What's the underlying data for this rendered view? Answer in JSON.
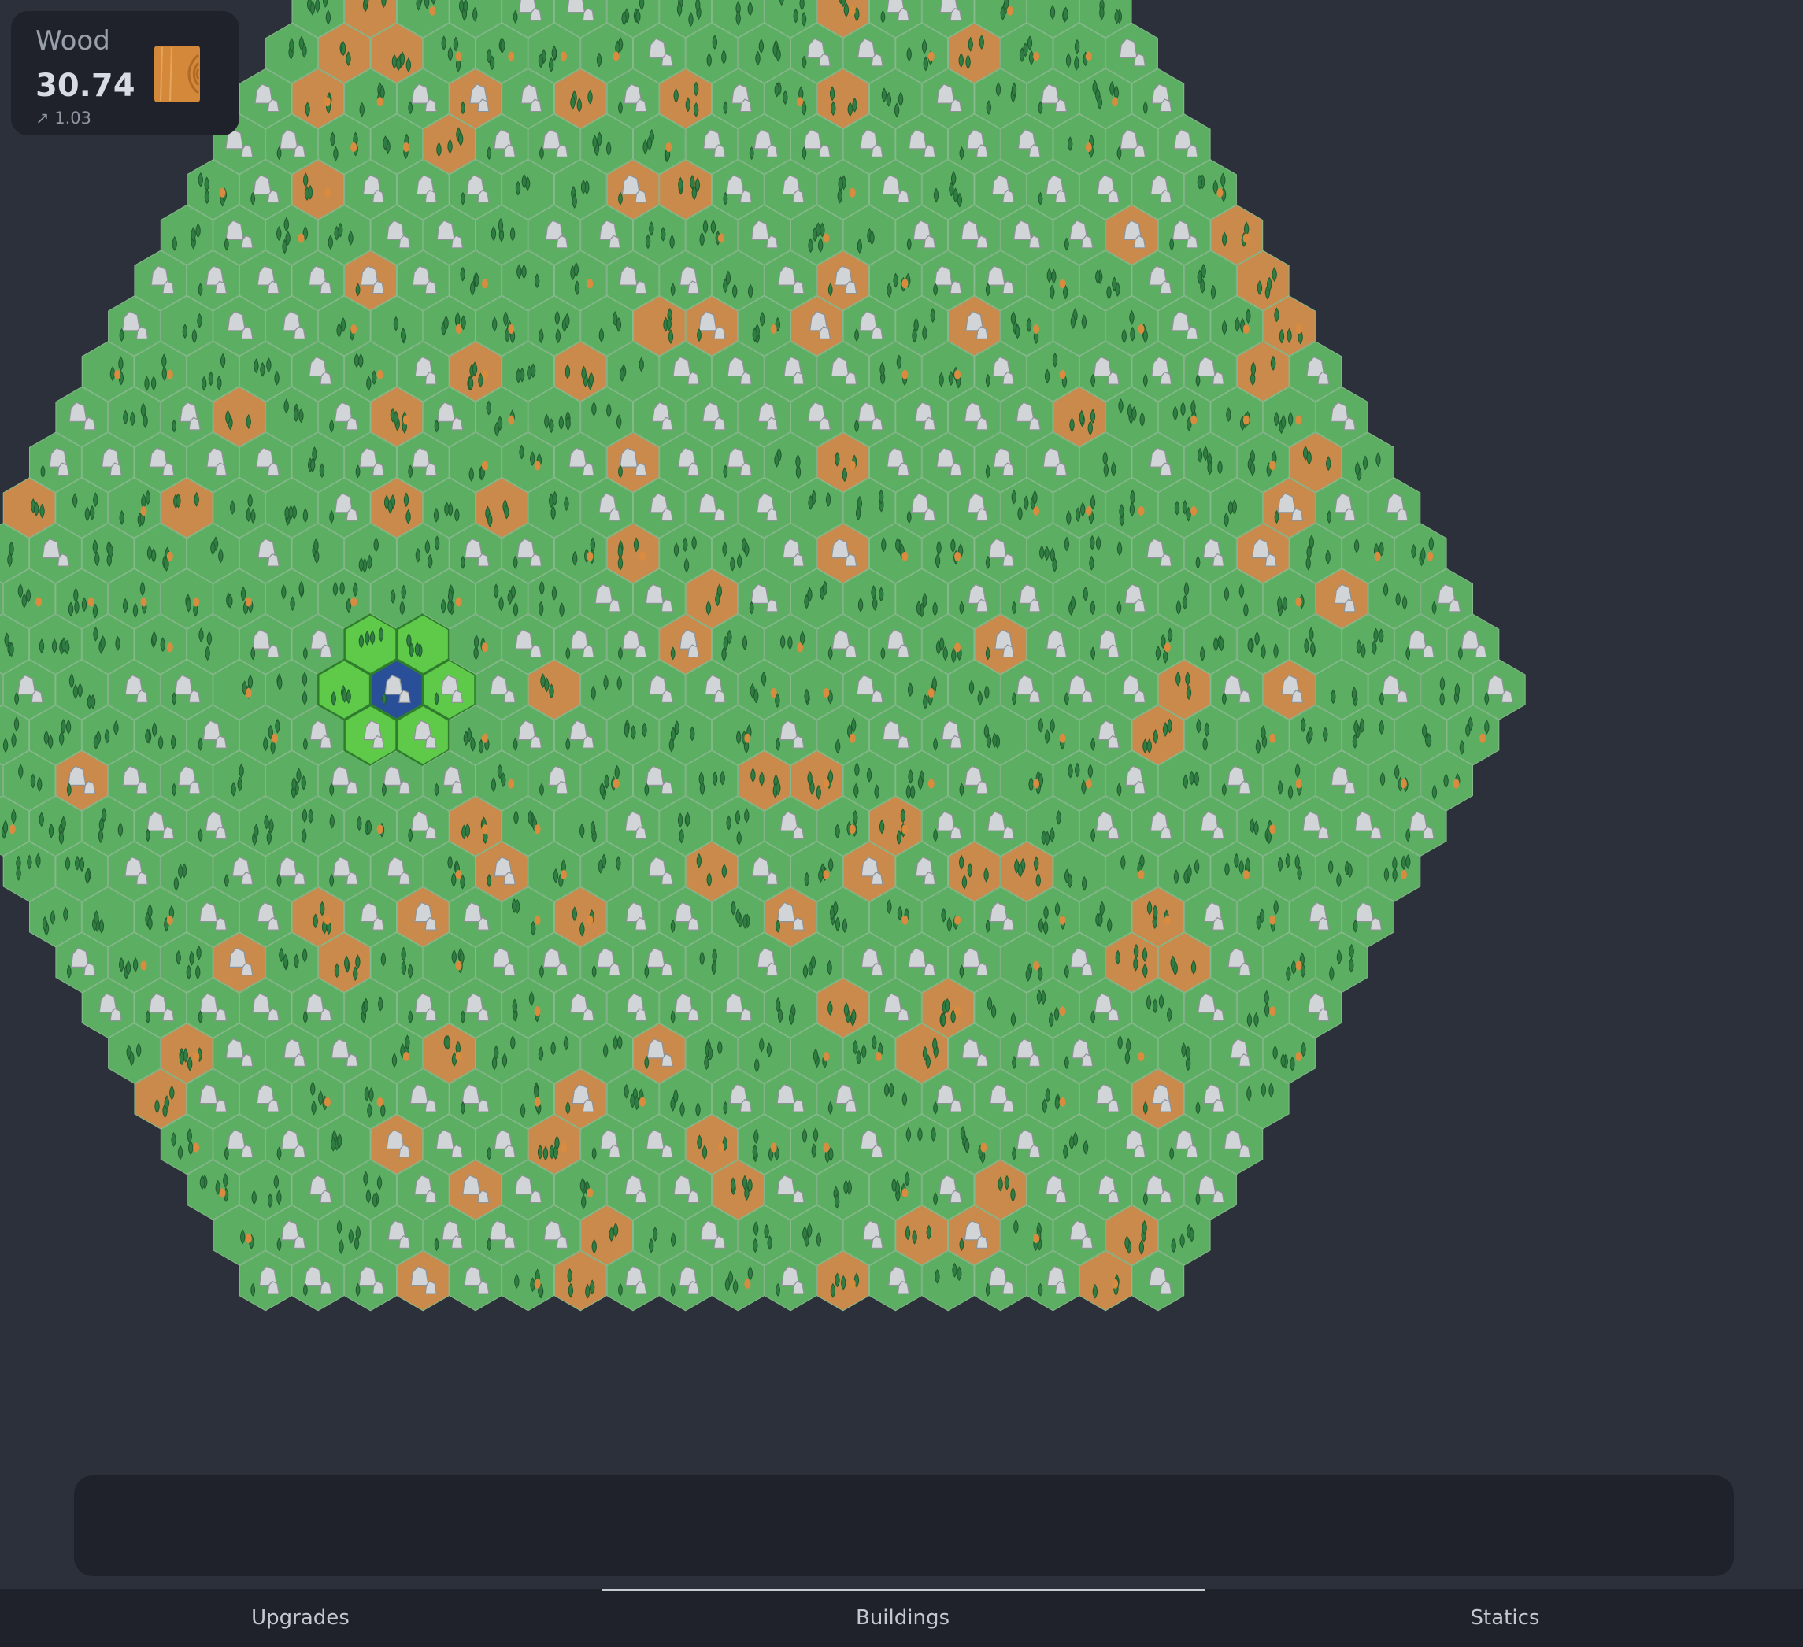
{
  "resource": {
    "name": "Wood",
    "value": "30.74",
    "rate": "↗ 1.03",
    "icon": "wood-log-icon",
    "icon_color": "#d4893a"
  },
  "map": {
    "tile_types": [
      "grass-forest",
      "grass-rock",
      "dirt-forest",
      "dirt-rock",
      "selected-area",
      "water-forest"
    ],
    "colors": {
      "grass": "#5cae62",
      "dirt": "#c98a4b",
      "selected": "#5fca4a",
      "water": "#2a4f99",
      "tree": "#2f7d42",
      "rock": "#d2d5d8",
      "tile_outline": "#87b98c"
    }
  },
  "tabs": [
    {
      "label": "Upgrades",
      "active": false
    },
    {
      "label": "Buildings",
      "active": true
    },
    {
      "label": "Statics",
      "active": false
    }
  ]
}
